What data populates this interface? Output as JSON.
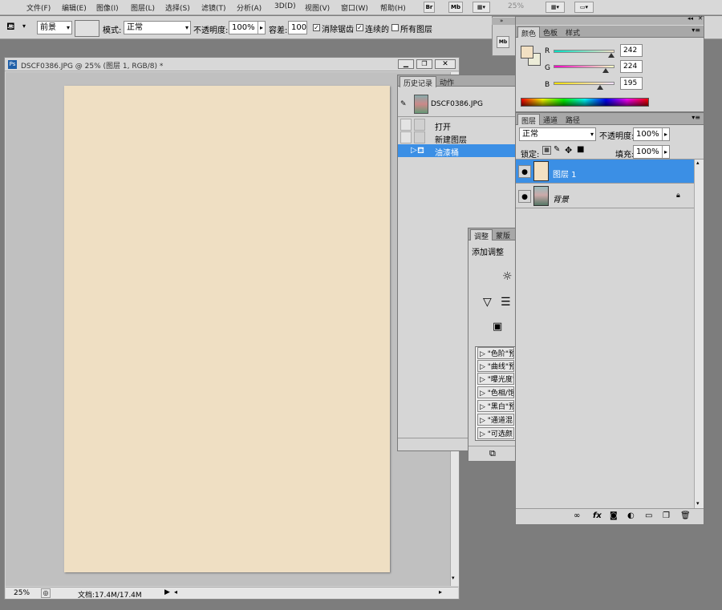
{
  "menubar": {
    "items": [
      "文件(F)",
      "编辑(E)",
      "图像(I)",
      "图层(L)",
      "选择(S)",
      "滤镜(T)",
      "分析(A)",
      "3D(D)",
      "视图(V)",
      "窗口(W)",
      "帮助(H)"
    ],
    "br": "Br",
    "mb": "Mb",
    "zoom": "25%"
  },
  "options": {
    "fill_source": "前景",
    "mode_label": "模式:",
    "mode_value": "正常",
    "opacity_label": "不透明度:",
    "opacity_value": "100%",
    "tolerance_label": "容差:",
    "tolerance_value": "100",
    "antialias_label": "消除锯齿",
    "contiguous_label": "连续的",
    "all_layers_label": "所有图层"
  },
  "document": {
    "title": "DSCF0386.JPG @ 25% (图层 1, RGB/8) *",
    "status_zoom": "25%",
    "status_doc": "文档:17.4M/17.4M",
    "canvas_color": "#efdfc3"
  },
  "history": {
    "tabs": [
      "历史记录",
      "动作"
    ],
    "snapshot_name": "DSCF0386.JPG",
    "items": [
      "打开",
      "新建图层",
      "油漆桶"
    ]
  },
  "adjustments": {
    "tabs": [
      "调整",
      "蒙版"
    ],
    "heading": "添加调整",
    "presets": [
      "\"色阶\"预",
      "\"曲线\"预",
      "\"曝光度\"",
      "\"色相/饱",
      "\"黑白\"预",
      "\"通道混",
      "\"可选颜"
    ]
  },
  "color": {
    "tabs": [
      "颜色",
      "色板",
      "样式"
    ],
    "r_label": "R",
    "g_label": "G",
    "b_label": "B",
    "r": "242",
    "g": "224",
    "b": "195",
    "swatch": "#f2e0c3"
  },
  "layers": {
    "tabs": [
      "图层",
      "通道",
      "路径"
    ],
    "blend_mode": "正常",
    "opacity_label": "不透明度:",
    "opacity_value": "100%",
    "lock_label": "锁定:",
    "fill_label": "填充:",
    "fill_value": "100%",
    "items": [
      "图层 1",
      "背景"
    ]
  }
}
